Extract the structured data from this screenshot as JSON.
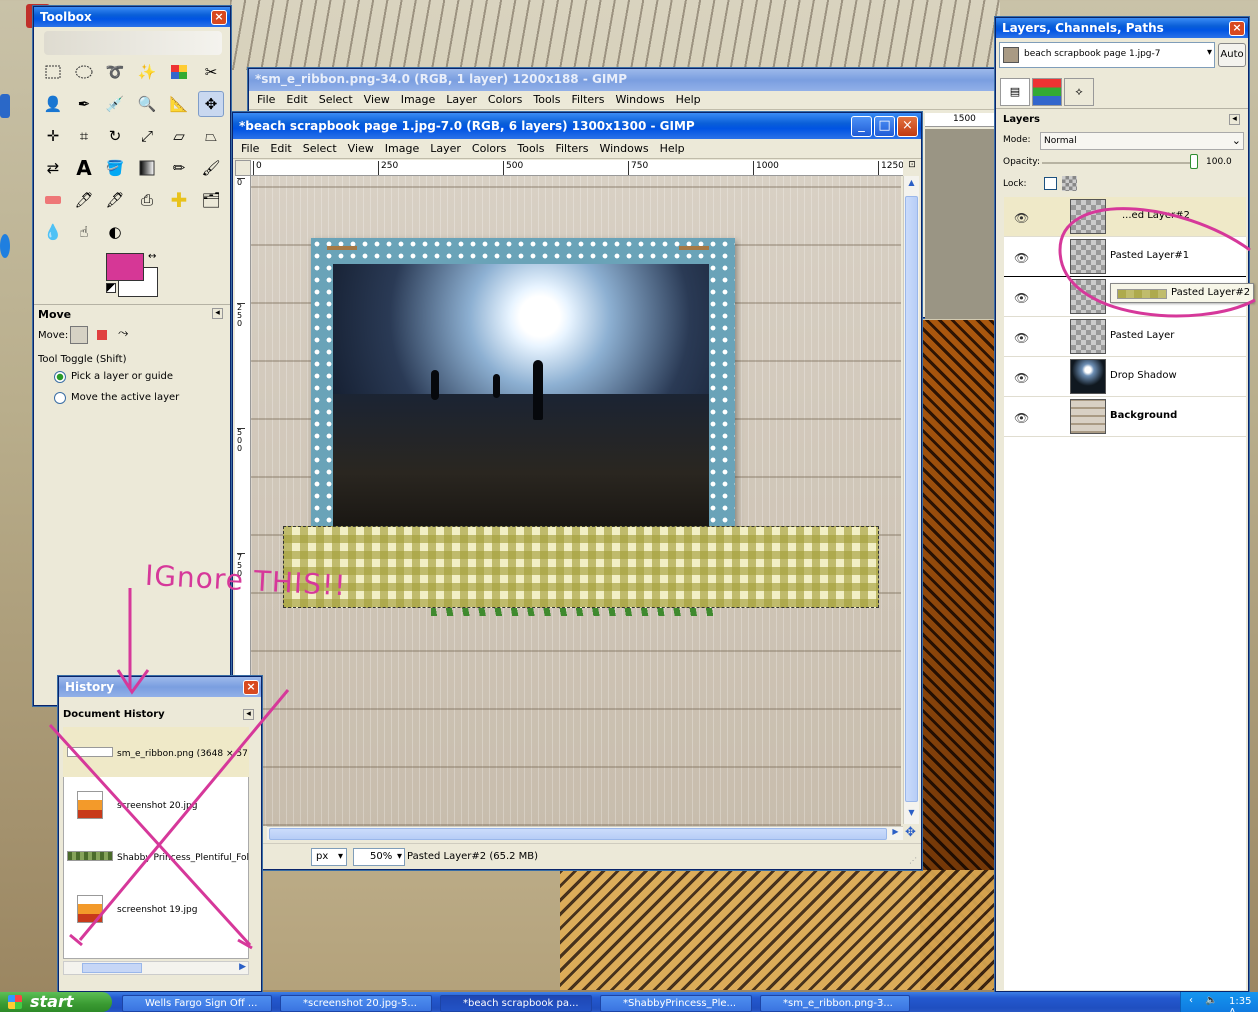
{
  "toolbox": {
    "title": "Toolbox",
    "tool_options_title": "Move",
    "move_label": "Move:",
    "tool_toggle": "Tool Toggle  (Shift)",
    "radio_pick": "Pick a layer or guide",
    "radio_move_active": "Move the active layer",
    "fg_color": "#d63796",
    "bg_color": "#ffffff"
  },
  "ribbon_window": {
    "title": "*sm_e_ribbon.png-34.0 (RGB, 1 layer) 1200x188 - GIMP",
    "ruler_mark": "1500",
    "menu": [
      "File",
      "Edit",
      "Select",
      "View",
      "Image",
      "Layer",
      "Colors",
      "Tools",
      "Filters",
      "Windows",
      "Help"
    ]
  },
  "image_window": {
    "title": "*beach scrapbook page 1.jpg-7.0 (RGB, 6 layers) 1300x1300 - GIMP",
    "menu": [
      "File",
      "Edit",
      "Select",
      "View",
      "Image",
      "Layer",
      "Colors",
      "Tools",
      "Filters",
      "Windows",
      "Help"
    ],
    "ruler_h_ticks": [
      "0",
      "250",
      "500",
      "750",
      "1000",
      "1250"
    ],
    "ruler_v_ticks": [
      "0",
      "250",
      "500",
      "750"
    ],
    "unit": "px",
    "zoom": "50%",
    "status": "Pasted Layer#2 (65.2 MB)"
  },
  "layers_dock": {
    "title": "Layers, Channels, Paths",
    "image_select": "beach scrapbook page 1.jpg-7",
    "auto_button": "Auto",
    "panel_title": "Layers",
    "mode_label": "Mode:",
    "mode_value": "Normal",
    "opacity_label": "Opacity:",
    "opacity_value": "100.0",
    "lock_label": "Lock:",
    "layers": [
      {
        "name": "...ed Layer#2",
        "bold": false
      },
      {
        "name": "Pasted Layer#1",
        "bold": false
      },
      {
        "name": "",
        "bold": false
      },
      {
        "name": "Pasted Layer",
        "bold": false
      },
      {
        "name": "Drop Shadow",
        "bold": false
      },
      {
        "name": "Background",
        "bold": true
      }
    ],
    "drag_label": "Pasted Layer#2"
  },
  "history": {
    "title": "History",
    "panel_title": "Document History",
    "items": [
      "sm_e_ribbon.png (3648 × 57",
      "screenshot 20.jpg",
      "Shabby Princess_Plentiful_Fol",
      "screenshot 19.jpg"
    ]
  },
  "annotation": {
    "text": "IGnore THIS!!"
  },
  "taskbar": {
    "start": "start",
    "tasks": [
      "Wells Fargo Sign Off ...",
      "*screenshot 20.jpg-5...",
      "*beach scrapbook pa...",
      "*ShabbyPrincess_Ple...",
      "*sm_e_ribbon.png-3..."
    ],
    "clock": "1:35 A"
  }
}
